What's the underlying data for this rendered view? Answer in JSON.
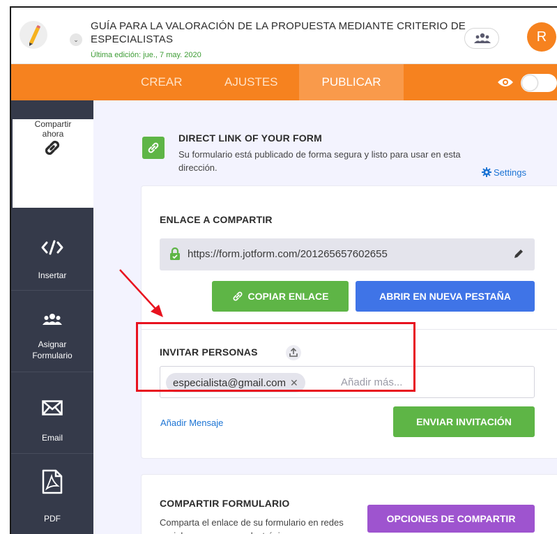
{
  "header": {
    "title": "GUÍA PARA LA VALORACIÓN DE LA PROPUESTA MEDIANTE CRITERIO DE ESPECIALISTAS",
    "last_edited": "Última edición: jue., 7 may. 2020",
    "avatar_initial": "R"
  },
  "nav": {
    "tabs": [
      {
        "label": "CREAR"
      },
      {
        "label": "AJUSTES"
      },
      {
        "label": "PUBLICAR",
        "active": true
      }
    ]
  },
  "sidebar": {
    "items": [
      {
        "label1": "Compartir",
        "label2": "ahora",
        "icon": "link-icon",
        "active": true
      },
      {
        "label1": "Insertar",
        "icon": "code-icon"
      },
      {
        "label1": "Asignar",
        "label2": "Formulario",
        "icon": "users-icon"
      },
      {
        "label1": "Email",
        "icon": "envelope-icon"
      },
      {
        "label1": "PDF",
        "icon": "pdf-icon"
      }
    ]
  },
  "direct_link": {
    "title": "DIRECT LINK OF YOUR FORM",
    "description": "Su formulario está publicado de forma segura y listo para usar en esta dirección.",
    "settings_label": "Settings"
  },
  "share_link": {
    "label": "ENLACE A COMPARTIR",
    "url": "https://form.jotform.com/201265657602655",
    "copy_button": "COPIAR ENLACE",
    "open_button": "ABRIR EN NUEVA PESTAÑA"
  },
  "invite": {
    "label": "INVITAR PERSONAS",
    "chip": "especialista@gmail.com",
    "placeholder": "Añadir más...",
    "add_message": "Añadir Mensaje",
    "send_button": "ENVIAR INVITACIÓN"
  },
  "share_form": {
    "label": "COMPARTIR FORMULARIO",
    "description": "Comparta el enlace de su formulario en redes sociales y por correo electrónico.",
    "options_button": "OPCIONES DE COMPARTIR"
  },
  "colors": {
    "brand_orange": "#f6821f",
    "green": "#5eb546",
    "blue": "#3f74e7",
    "purple": "#9e54cf",
    "annotation_red": "#e8121f"
  }
}
